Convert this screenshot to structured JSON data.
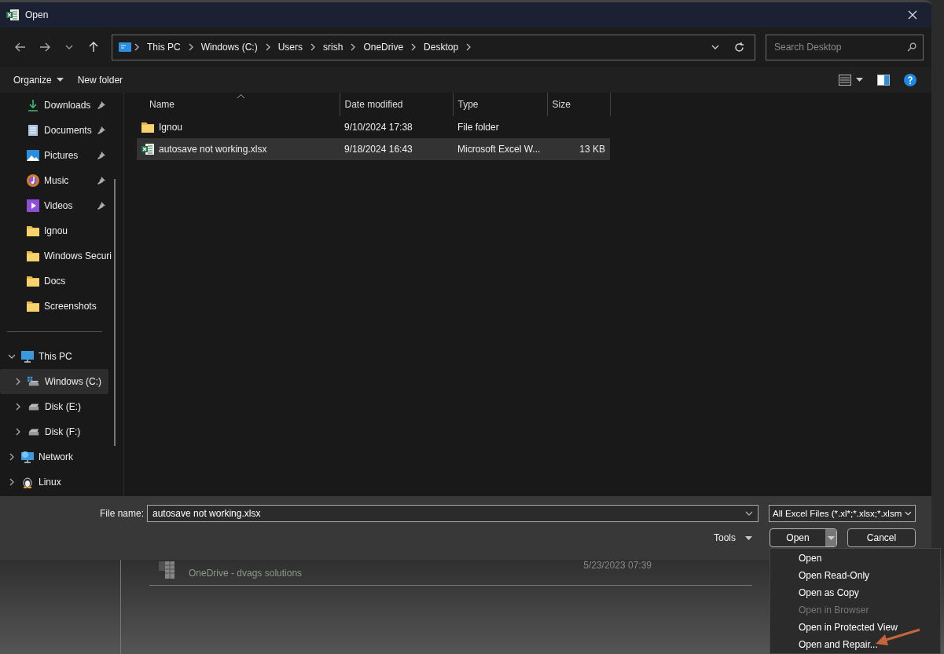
{
  "window": {
    "title": "Open"
  },
  "address_bar": {
    "segments": [
      "This PC",
      "Windows (C:)",
      "Users",
      "srish",
      "OneDrive",
      "Desktop"
    ]
  },
  "search": {
    "placeholder": "Search Desktop"
  },
  "toolbar": {
    "organize": "Organize",
    "new_folder": "New folder"
  },
  "sidebar": {
    "quick_access": [
      {
        "label": "Downloads",
        "kind": "download",
        "pinned": true
      },
      {
        "label": "Documents",
        "kind": "documents",
        "pinned": true
      },
      {
        "label": "Pictures",
        "kind": "pictures",
        "pinned": true
      },
      {
        "label": "Music",
        "kind": "music",
        "pinned": true
      },
      {
        "label": "Videos",
        "kind": "videos",
        "pinned": true
      },
      {
        "label": "Ignou",
        "kind": "folder",
        "pinned": false
      },
      {
        "label": "Windows Securi",
        "kind": "folder",
        "pinned": false
      },
      {
        "label": "Docs",
        "kind": "folder",
        "pinned": false
      },
      {
        "label": "Screenshots",
        "kind": "folder",
        "pinned": false
      }
    ],
    "tree": [
      {
        "label": "This PC",
        "kind": "pc",
        "expanded": true,
        "selected": false,
        "children": [
          {
            "label": "Windows (C:)",
            "kind": "system-drive",
            "expanded": false,
            "selected": true
          },
          {
            "label": "Disk (E:)",
            "kind": "drive",
            "expanded": false,
            "selected": false
          },
          {
            "label": "Disk (F:)",
            "kind": "drive",
            "expanded": false,
            "selected": false
          }
        ]
      },
      {
        "label": "Network",
        "kind": "network",
        "expanded": false,
        "selected": false
      },
      {
        "label": "Linux",
        "kind": "linux",
        "expanded": false,
        "selected": false
      }
    ]
  },
  "table": {
    "columns": [
      "Name",
      "Date modified",
      "Type",
      "Size"
    ],
    "rows": [
      {
        "kind": "folder",
        "name": "Ignou",
        "date": "9/10/2024 17:38",
        "type": "File folder",
        "selected": false
      },
      {
        "kind": "excel",
        "name": "autosave not working.xlsx",
        "date": "9/18/2024 16:43",
        "type": "Microsoft Excel W...",
        "size": "13 KB",
        "selected": true
      }
    ]
  },
  "file_name": {
    "label": "File name:",
    "value": "autosave not working.xlsx"
  },
  "file_type": {
    "value": "All Excel Files (*.xl*;*.xlsx;*.xlsm"
  },
  "tools": "Tools",
  "buttons": {
    "open": "Open",
    "cancel": "Cancel"
  },
  "open_menu": [
    {
      "label": "Open",
      "disabled": false
    },
    {
      "label": "Open Read-Only",
      "disabled": false
    },
    {
      "label": "Open as Copy",
      "disabled": false
    },
    {
      "label": "Open in Browser",
      "disabled": true
    },
    {
      "label": "Open in Protected View",
      "disabled": false
    },
    {
      "label": "Open and Repair...",
      "disabled": false
    }
  ],
  "background": {
    "recent_file": {
      "location": "OneDrive - dvags solutions",
      "date": "5/23/2023 07:39"
    }
  }
}
